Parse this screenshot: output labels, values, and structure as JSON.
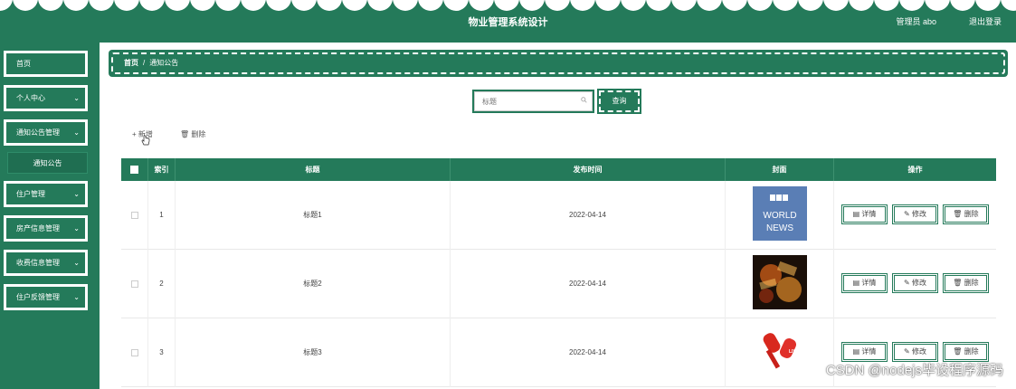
{
  "header": {
    "title": "物业管理系统设计",
    "user": "管理员 abo",
    "logout": "退出登录"
  },
  "sidebar": {
    "items": [
      {
        "label": "首页",
        "chevron": ""
      },
      {
        "label": "个人中心",
        "chevron": "⌄"
      },
      {
        "label": "通知公告管理",
        "chevron": "⌄"
      },
      {
        "label": "住户管理",
        "chevron": "⌄"
      },
      {
        "label": "房产信息管理",
        "chevron": "⌄"
      },
      {
        "label": "收费信息管理",
        "chevron": "⌄"
      },
      {
        "label": "住户反馈管理",
        "chevron": "⌄"
      }
    ],
    "subitem": "通知公告"
  },
  "breadcrumb": {
    "home": "首页",
    "separator": "/",
    "current": "通知公告"
  },
  "search": {
    "placeholder": "标题",
    "button": "查询"
  },
  "toolbar": {
    "add": "+ 新增",
    "delete": "删除"
  },
  "table": {
    "headers": [
      "",
      "索引",
      "标题",
      "发布时间",
      "封面",
      "操作"
    ],
    "rows": [
      {
        "index": "1",
        "title": "标题1",
        "date": "2022-04-14",
        "cover": "BBC WORLD NEWS"
      },
      {
        "index": "2",
        "title": "标题2",
        "date": "2022-04-14",
        "cover": "news-collage"
      },
      {
        "index": "3",
        "title": "标题3",
        "date": "2022-04-14",
        "cover": "live-microphone"
      }
    ],
    "actions": {
      "detail": "详情",
      "edit": "修改",
      "delete": "删除"
    }
  },
  "watermark": "CSDN @nodejs毕设程序源码",
  "colors": {
    "primary": "#247a5a",
    "white": "#ffffff"
  }
}
